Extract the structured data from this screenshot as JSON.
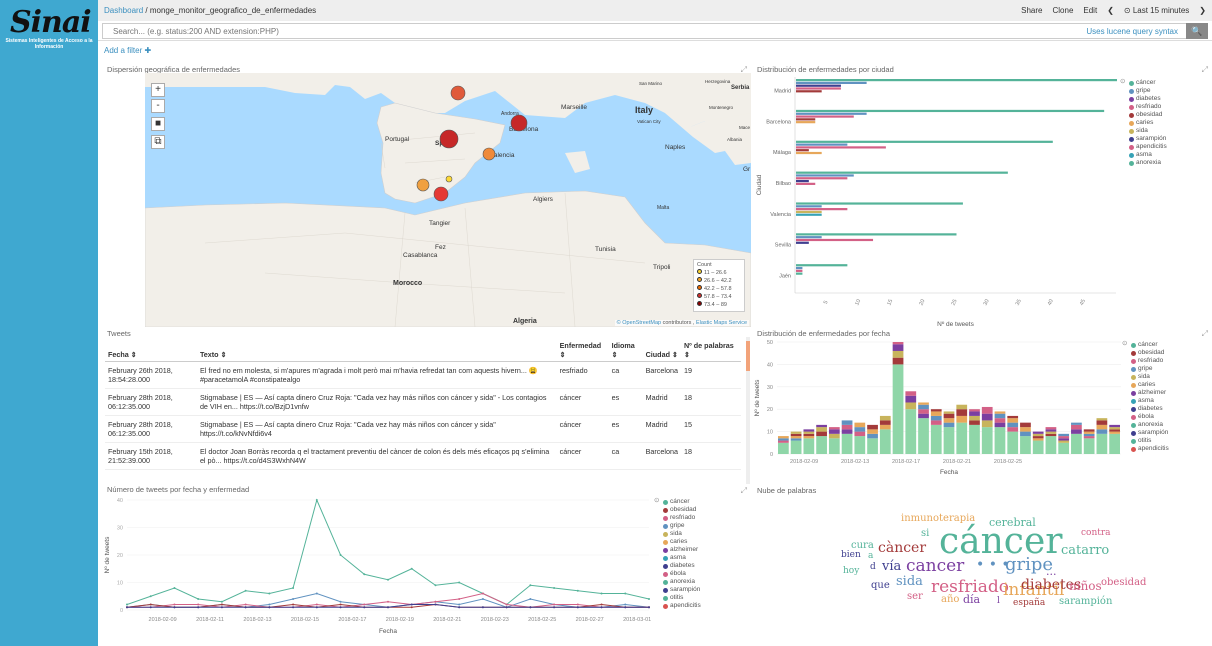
{
  "brand": {
    "name": "Sinai",
    "tagline": "Sistemas Inteligentes de Acceso a la Información"
  },
  "topbar": {
    "crumb_link": "Dashboard",
    "crumb_sep": "/",
    "crumb_current": "monge_monitor_geografico_de_enfermedades",
    "share": "Share",
    "clone": "Clone",
    "edit": "Edit",
    "prev": "❮",
    "time": "⊙ Last 15 minutes",
    "next": "❯"
  },
  "search": {
    "placeholder": "Search... (e.g. status:200 AND extension:PHP)",
    "lucene": "Uses lucene query syntax",
    "button": "🔍"
  },
  "filter": {
    "add": "Add a filter ✚"
  },
  "map": {
    "title": "Dispersión geográfica de enfermedades",
    "labels": {
      "spain": "Spain",
      "portugal": "Portugal",
      "italy": "Italy",
      "marseille": "Marseille",
      "barcelona": "Barcelona",
      "valencia": "Valencia",
      "andorra": "Andorra",
      "tangier": "Tangier",
      "fez": "Fez",
      "casablanca": "Casablanca",
      "morocco": "Morocco",
      "algeria": "Algeria",
      "algiers": "Algiers",
      "tunisia": "Tunisia",
      "tripoli": "Tripoli",
      "malta": "Malta",
      "naples": "Naples",
      "vatican": "Vatican City",
      "serbia": "Serbia",
      "montenegro": "Montenegro",
      "macedonia": "Mace",
      "albania": "Albania",
      "sanmarino": "San Marino",
      "bosnia": "Herzegovina",
      "gr": "Gr"
    },
    "legend": {
      "title": "Count",
      "items": [
        {
          "label": "11 – 26.6",
          "color": "#fdd835"
        },
        {
          "label": "26.6 – 42.2",
          "color": "#f9a825"
        },
        {
          "label": "42.2 – 57.8",
          "color": "#ef6c00"
        },
        {
          "label": "57.8 – 73.4",
          "color": "#d32f2f"
        },
        {
          "label": "73.4 – 89",
          "color": "#8b0000"
        }
      ]
    },
    "attribution": {
      "osm": "© OpenStreetMap",
      "contrib": "contributors ,",
      "ems": "Elastic Maps Service"
    },
    "tools": [
      "+",
      "-",
      "■",
      "⧉"
    ]
  },
  "city_chart": {
    "title": "Distribución de enfermedades por ciudad"
  },
  "tweets": {
    "title": "Tweets",
    "headers": {
      "fecha": "Fecha ⇕",
      "texto": "Texto ⇕",
      "enfermedad": "Enfermedad ⇕",
      "idioma": "Idioma ⇕",
      "ciudad": "Ciudad ⇕",
      "palabras": "Nº de palabras ⇕"
    },
    "rows": [
      {
        "fecha": "February 26th 2018, 18:54:28.000",
        "texto": "El fred no em molesta, si m'apures m'agrada i molt però mai m'havia refredat tan com aquests hivern... 😩 #paracetamolA #constipatealgo",
        "enfermedad": "resfriado",
        "idioma": "ca",
        "ciudad": "Barcelona",
        "palabras": "19"
      },
      {
        "fecha": "February 28th 2018, 06:12:35.000",
        "texto": "Stigmabase | ES — Así capta dinero Cruz Roja: \"Cada vez hay más niños con cáncer y sida\" - Los contagios de VIH en... https://t.co/BzjD1vnfw",
        "enfermedad": "cáncer",
        "idioma": "es",
        "ciudad": "Madrid",
        "palabras": "18"
      },
      {
        "fecha": "February 28th 2018, 06:12:35.000",
        "texto": "Stigmabase | ES — Así capta dinero Cruz Roja: \"Cada vez hay más niños con cáncer y sida\" https://t.co/kNvNfdi6v4",
        "enfermedad": "cáncer",
        "idioma": "es",
        "ciudad": "Madrid",
        "palabras": "15"
      },
      {
        "fecha": "February 15th 2018, 21:52:39.000",
        "texto": "El doctor Joan Borràs recorda q el tractament preventiu del càncer de colon és dels més eficaços pq s'elimina el pò... https://t.co/d4S3WxhN4W",
        "enfermedad": "cáncer",
        "idioma": "ca",
        "ciudad": "Barcelona",
        "palabras": "18"
      }
    ]
  },
  "date_chart": {
    "title": "Distribución de enfermedades por fecha"
  },
  "line_chart": {
    "title": "Número de tweets por fecha y enfermedad"
  },
  "cloud": {
    "title": "Nube de palabras",
    "words": [
      {
        "w": "cáncer",
        "c": "#54b399"
      },
      {
        "w": "gripe",
        "c": "#6092c0"
      },
      {
        "w": "cancer",
        "c": "#7b3fa0"
      },
      {
        "w": "• • •",
        "c": "#6092c0"
      },
      {
        "w": "resfriado",
        "c": "#d36086"
      },
      {
        "w": "infantil",
        "c": "#e7a75a"
      },
      {
        "w": "càncer",
        "c": "#a33a3a"
      },
      {
        "w": "diabetes",
        "c": "#a33a3a"
      },
      {
        "w": "catarro",
        "c": "#54b399"
      },
      {
        "w": "contra",
        "c": "#d36086"
      },
      {
        "w": "inmunoterapia",
        "c": "#e7a75a"
      },
      {
        "w": "cerebral",
        "c": "#54b399"
      },
      {
        "w": "vía",
        "c": "#3f3f8f"
      },
      {
        "w": "cura",
        "c": "#54b399"
      },
      {
        "w": "si",
        "c": "#54b399"
      },
      {
        "w": "bien",
        "c": "#3f3f8f"
      },
      {
        "w": "a",
        "c": "#54b399"
      },
      {
        "w": "d",
        "c": "#3f3f8f"
      },
      {
        "w": "hoy",
        "c": "#54b399"
      },
      {
        "w": "que",
        "c": "#3f3f8f"
      },
      {
        "w": "sida",
        "c": "#6092c0"
      },
      {
        "w": "ser",
        "c": "#d36086"
      },
      {
        "w": "año",
        "c": "#e7a75a"
      },
      {
        "w": "día",
        "c": "#7b3fa0"
      },
      {
        "w": "l",
        "c": "#7b3fa0"
      },
      {
        "w": "españa",
        "c": "#a33a3a"
      },
      {
        "w": "sarampión",
        "c": "#54b399"
      },
      {
        "w": "niños",
        "c": "#d36086"
      },
      {
        "w": "obesidad",
        "c": "#d36086"
      },
      {
        "w": "...",
        "c": "#7b3fa0"
      }
    ]
  },
  "chart_data": [
    {
      "type": "bar",
      "title": "Distribución de enfermedades por ciudad",
      "orientation": "horizontal",
      "xlabel": "Nº de tweets",
      "ylabel": "Ciudad",
      "categories": [
        "Madrid",
        "Barcelona",
        "Málaga",
        "Bilbao",
        "Valencia",
        "Sevilla",
        "Jaén"
      ],
      "x_ticks": [
        "5",
        "10",
        "15",
        "20",
        "25",
        "30",
        "35",
        "40",
        "45"
      ],
      "xlim": [
        0,
        50
      ],
      "series": [
        {
          "name": "cáncer",
          "color": "#54b399",
          "values": [
            50,
            48,
            40,
            33,
            26,
            25,
            8
          ]
        },
        {
          "name": "gripe",
          "color": "#6092c0",
          "values": [
            11,
            11,
            8,
            9,
            4,
            4,
            1
          ]
        },
        {
          "name": "diabetes",
          "color": "#3f3f8f",
          "values": [
            7,
            0,
            0,
            0,
            0,
            0,
            0
          ]
        },
        {
          "name": "resfriado",
          "color": "#d36086",
          "values": [
            7,
            9,
            14,
            8,
            8,
            12,
            0
          ]
        },
        {
          "name": "obesidad",
          "color": "#a33a3a",
          "values": [
            4,
            3,
            2,
            0,
            0,
            0,
            0
          ]
        },
        {
          "name": "caries",
          "color": "#e7a75a",
          "values": [
            0,
            3,
            4,
            0,
            0,
            0,
            0
          ]
        },
        {
          "name": "sida",
          "color": "#c8b45c",
          "values": [
            0,
            0,
            0,
            0,
            4,
            0,
            0
          ]
        },
        {
          "name": "sarampión",
          "color": "#3f3f8f",
          "values": [
            0,
            0,
            0,
            2,
            0,
            2,
            0
          ]
        },
        {
          "name": "apendicitis",
          "color": "#d36086",
          "values": [
            0,
            0,
            0,
            3,
            0,
            0,
            1
          ]
        },
        {
          "name": "asma",
          "color": "#36a2b6",
          "values": [
            0,
            0,
            0,
            0,
            4,
            0,
            0
          ]
        },
        {
          "name": "anorexia",
          "color": "#54b399",
          "values": [
            0,
            0,
            0,
            0,
            0,
            0,
            1
          ]
        }
      ],
      "legend": [
        "cáncer",
        "gripe",
        "diabetes",
        "resfriado",
        "obesidad",
        "caries",
        "sida",
        "sarampión",
        "apendicitis",
        "asma",
        "anorexia"
      ],
      "legend_colors": [
        "#54b399",
        "#6092c0",
        "#7b3fa0",
        "#d36086",
        "#a33a3a",
        "#e7a75a",
        "#c8b45c",
        "#3f3f8f",
        "#d36086",
        "#36a2b6",
        "#54b399"
      ]
    },
    {
      "type": "bar",
      "stacked": true,
      "title": "Distribución de enfermedades por fecha",
      "xlabel": "Fecha",
      "ylabel": "Nº de tweets",
      "ylim": [
        0,
        50
      ],
      "y_ticks": [
        "0",
        "10",
        "20",
        "30",
        "40",
        "50"
      ],
      "x_ticks": [
        "2018-02-09",
        "2018-02-13",
        "2018-02-17",
        "2018-02-21",
        "2018-02-25"
      ],
      "totals": [
        8,
        10,
        11,
        13,
        12,
        15,
        14,
        13,
        17,
        50,
        28,
        23,
        20,
        19,
        22,
        20,
        21,
        19,
        17,
        14,
        10,
        12,
        9,
        14,
        11,
        16,
        13
      ],
      "cancer": [
        5,
        6,
        7,
        8,
        7,
        9,
        8,
        7,
        11,
        40,
        20,
        16,
        13,
        12,
        14,
        13,
        12,
        12,
        10,
        8,
        6,
        8,
        5,
        9,
        7,
        9,
        9
      ],
      "legend": [
        "cáncer",
        "obesidad",
        "resfriado",
        "gripe",
        "sida",
        "caries",
        "alzheimer",
        "asma",
        "diabetes",
        "ébola",
        "anorexia",
        "sarampión",
        "otitis",
        "apendicitis"
      ],
      "legend_colors": [
        "#54b399",
        "#a33a3a",
        "#d36086",
        "#6092c0",
        "#c8b45c",
        "#e7a75a",
        "#7b3fa0",
        "#36a2b6",
        "#3f3f8f",
        "#d36086",
        "#54b399",
        "#3f3f8f",
        "#54b399",
        "#d9534f"
      ]
    },
    {
      "type": "line",
      "title": "Número de tweets por fecha y enfermedad",
      "xlabel": "Fecha",
      "ylabel": "Nº de tweets",
      "ylim": [
        0,
        40
      ],
      "y_ticks": [
        "0",
        "10",
        "20",
        "30",
        "40"
      ],
      "x_ticks": [
        "2018-02-09",
        "2018-02-11",
        "2018-02-13",
        "2018-02-15",
        "2018-02-17",
        "2018-02-19",
        "2018-02-21",
        "2018-02-23",
        "2018-02-25",
        "2018-02-27",
        "2018-03-01"
      ],
      "series": [
        {
          "name": "cáncer",
          "color": "#54b399",
          "values": [
            2,
            5,
            8,
            4,
            3,
            7,
            6,
            8,
            40,
            20,
            13,
            11,
            15,
            9,
            10,
            6,
            2,
            9,
            8,
            7,
            6,
            6,
            4
          ]
        },
        {
          "name": "gripe",
          "color": "#6092c0",
          "values": [
            1,
            2,
            1,
            1,
            2,
            1,
            2,
            4,
            6,
            3,
            2,
            1,
            2,
            3,
            2,
            4,
            1,
            4,
            2,
            1,
            1,
            2,
            1
          ]
        },
        {
          "name": "resfriado",
          "color": "#d36086",
          "values": [
            1,
            1,
            2,
            2,
            1,
            2,
            1,
            1,
            2,
            1,
            2,
            3,
            2,
            3,
            4,
            6,
            2,
            1,
            2,
            2,
            1,
            1,
            1
          ]
        },
        {
          "name": "obesidad",
          "color": "#a33a3a",
          "values": [
            1,
            2,
            1,
            1,
            2,
            1,
            1,
            2,
            1,
            2,
            1,
            1,
            1,
            2,
            1,
            1,
            1,
            1,
            1,
            1,
            2,
            1,
            1
          ]
        },
        {
          "name": "diabetes",
          "color": "#3f3f8f",
          "values": [
            1,
            1,
            1,
            1,
            1,
            1,
            1,
            1,
            1,
            1,
            1,
            1,
            2,
            2,
            1,
            1,
            1,
            1,
            1,
            1,
            1,
            1,
            1
          ]
        }
      ],
      "legend": [
        "cáncer",
        "obesidad",
        "resfriado",
        "gripe",
        "sida",
        "caries",
        "alzheimer",
        "asma",
        "diabetes",
        "ébola",
        "anorexia",
        "sarampión",
        "otitis",
        "apendicitis"
      ],
      "legend_colors": [
        "#54b399",
        "#a33a3a",
        "#d36086",
        "#6092c0",
        "#c8b45c",
        "#e7a75a",
        "#7b3fa0",
        "#36a2b6",
        "#3f3f8f",
        "#d36086",
        "#54b399",
        "#3f3f8f",
        "#54b399",
        "#d9534f"
      ]
    }
  ]
}
